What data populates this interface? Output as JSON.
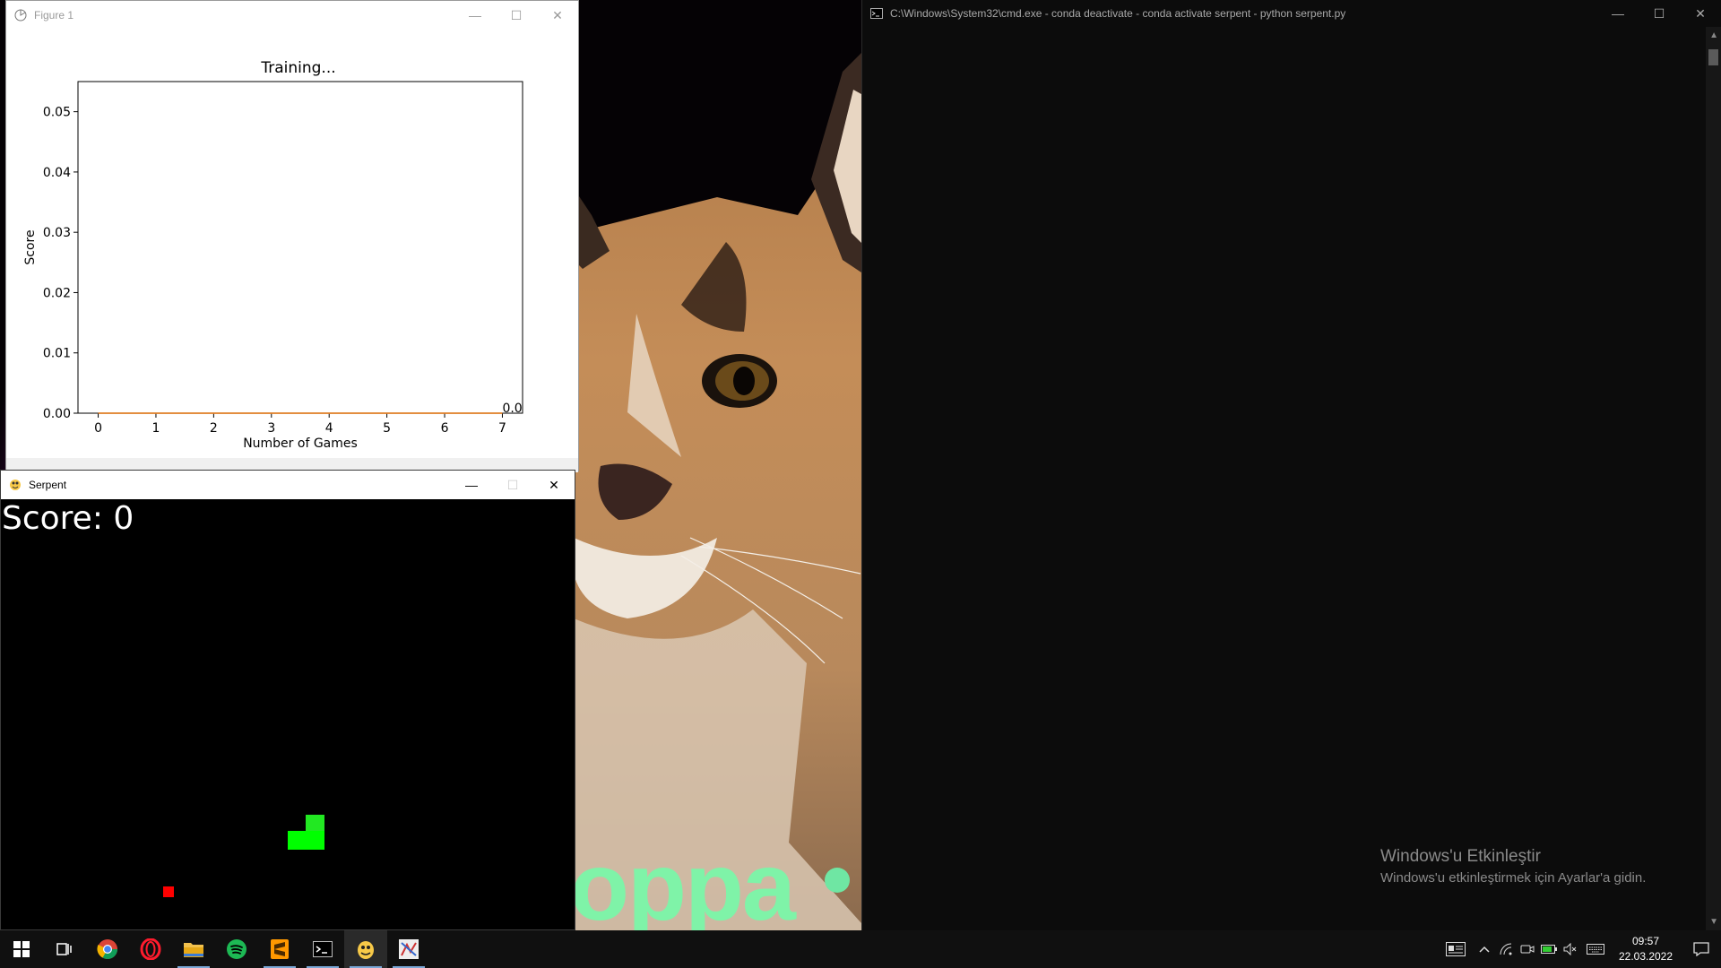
{
  "figure_window": {
    "title": "Figure 1",
    "controls": {
      "minimize": "—",
      "maximize": "☐",
      "close": "✕"
    }
  },
  "chart_data": {
    "type": "line",
    "title": "Training...",
    "xlabel": "Number of Games",
    "ylabel": "Score",
    "xlim": [
      -0.35,
      7.35
    ],
    "ylim": [
      0,
      0.055
    ],
    "x_ticks": [
      "0",
      "1",
      "2",
      "3",
      "4",
      "5",
      "6",
      "7"
    ],
    "y_ticks": [
      "0.00",
      "0.01",
      "0.02",
      "0.03",
      "0.04",
      "0.05"
    ],
    "x": [
      0,
      1,
      2,
      3,
      4,
      5,
      6,
      7
    ],
    "series": [
      {
        "values": [
          0,
          0,
          0,
          0,
          0,
          0,
          0,
          0
        ],
        "color": "#1f77b4"
      },
      {
        "values": [
          0,
          0,
          0,
          0,
          0,
          0,
          0,
          0
        ],
        "color": "#ff7f0e"
      }
    ],
    "annotation": {
      "text": "0.0",
      "x": 7,
      "y": 0
    }
  },
  "serpent_window": {
    "title": "Serpent",
    "controls": {
      "minimize": "—",
      "maximize": "☐",
      "close": "✕"
    },
    "score_text": "Score: 0",
    "colors": {
      "snake": "#00ff00",
      "food": "#ff0000",
      "background": "#000000"
    }
  },
  "cmd_window": {
    "title": "C:\\Windows\\System32\\cmd.exe - conda  deactivate - conda  activate serpent - python  serpent.py",
    "controls": {
      "minimize": "—",
      "maximize": "☐",
      "close": "✕"
    },
    "activation_title": "Windows'u Etkinleştir",
    "activation_subtitle": "Windows'u etkinleştirmek için Ayarlar'a gidin."
  },
  "wallpaper": {
    "text": "oppa"
  },
  "taskbar": {
    "apps": [
      "start-icon",
      "task-view-icon",
      "chrome-icon",
      "opera-icon",
      "file-explorer-icon",
      "spotify-icon",
      "sublime-text-icon",
      "terminal-icon",
      "python-icon",
      "figure-app-icon"
    ],
    "clock_time": "09:57",
    "clock_date": "22.03.2022"
  }
}
